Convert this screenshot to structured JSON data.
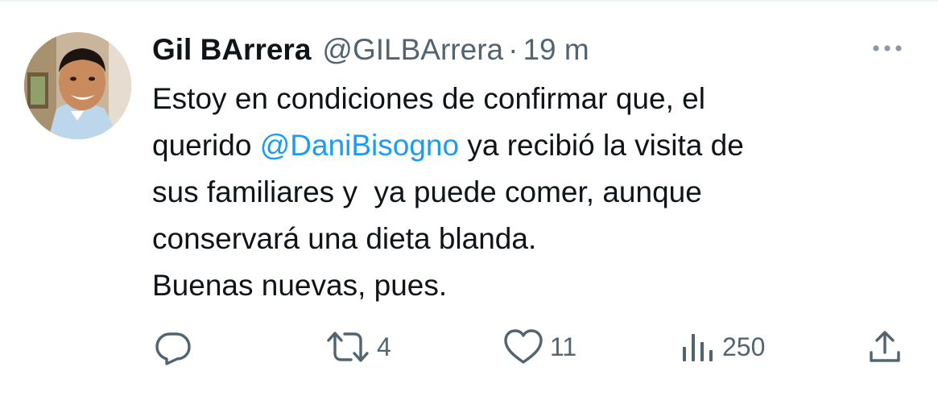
{
  "tweet": {
    "author_name": "Gil BArrera",
    "author_handle": "@GILBArrera",
    "separator": "·",
    "time": "19 m",
    "text_lines": [
      {
        "pre": "Estoy en condiciones de confirmar que, el",
        "mention": "",
        "post": ""
      },
      {
        "pre": "querido ",
        "mention": "@DaniBisogno",
        "post": " ya recibió la visita de"
      },
      {
        "pre": "sus familiares y  ya puede comer, aunque",
        "mention": "",
        "post": ""
      },
      {
        "pre": "conservará una dieta blanda.",
        "mention": "",
        "post": ""
      },
      {
        "pre": "Buenas nuevas, pues.",
        "mention": "",
        "post": ""
      }
    ]
  },
  "actions": {
    "reply": {
      "icon": "reply-icon",
      "count": ""
    },
    "retweet": {
      "icon": "retweet-icon",
      "count": "4"
    },
    "like": {
      "icon": "heart-icon",
      "count": "11"
    },
    "views": {
      "icon": "views-icon",
      "count": "250"
    },
    "share": {
      "icon": "share-icon",
      "count": ""
    }
  },
  "colors": {
    "text": "#0f1419",
    "secondary": "#536471",
    "link": "#1d9bf0",
    "divider": "#eff3f4"
  }
}
